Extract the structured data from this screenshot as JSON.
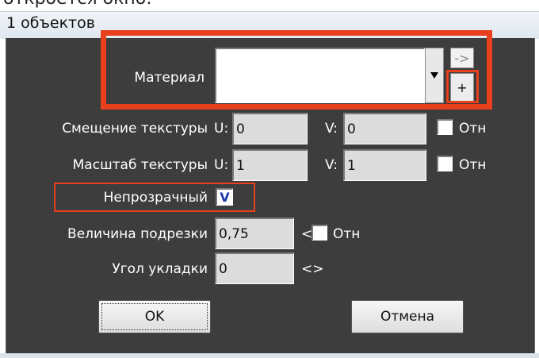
{
  "window": {
    "caption_fragment": "откроется окно:",
    "title": "1 объектов"
  },
  "material": {
    "label": "Материал",
    "value": "",
    "dropdown_icon": "triangle-down",
    "arrow_button_label": "->",
    "add_button_label": "+"
  },
  "texture_offset": {
    "label": "Смещение текстуры",
    "u_label": "U:",
    "u_value": "0",
    "v_label": "V:",
    "v_value": "0",
    "relative_label": "Отн",
    "relative_checked": false
  },
  "texture_scale": {
    "label": "Масштаб текстуры",
    "u_label": "U:",
    "u_value": "1",
    "v_label": "V:",
    "v_value": "1",
    "relative_label": "Отн",
    "relative_checked": false
  },
  "opaque": {
    "label": "Непрозрачный",
    "checked": true,
    "check_mark": "V"
  },
  "trim": {
    "label": "Величина подрезки",
    "value": "0,75",
    "prefix": "<",
    "relative_label": "Отн",
    "relative_checked": false
  },
  "laying_angle": {
    "label": "Угол укладки",
    "value": "0",
    "suffix": "<>"
  },
  "buttons": {
    "ok_label": "OK",
    "cancel_label": "Отмена"
  },
  "colors": {
    "dialog_background": "#3d3d3d",
    "highlight_red": "#e8401c",
    "label_text": "#ffffff"
  }
}
